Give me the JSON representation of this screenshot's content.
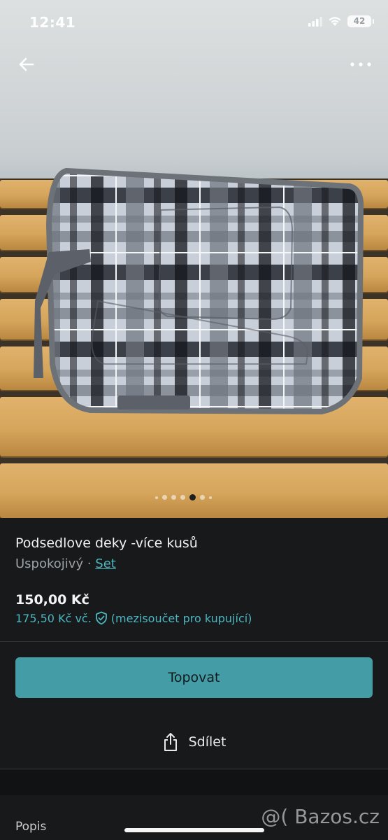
{
  "status_bar": {
    "time": "12:41",
    "battery": "42"
  },
  "gallery": {
    "pages": 7,
    "active_index": 4
  },
  "listing": {
    "title": "Podsedlove deky -více kusů",
    "condition": "Uspokojivý",
    "separator": "·",
    "category": "Set",
    "price": "150,00 Kč",
    "price_incl": "175,50 Kč vč.",
    "price_incl_note": "(mezisoučet pro kupující)"
  },
  "actions": {
    "bump_label": "Topovat",
    "share_label": "Sdílet"
  },
  "description": {
    "label": "Popis"
  },
  "watermark": "@( Bazos.cz",
  "icons": [
    "back-arrow-icon",
    "more-icon",
    "shield-check-icon",
    "share-icon",
    "signal-icon",
    "wifi-icon"
  ],
  "colors": {
    "accent": "#449da6",
    "link": "#4db6c0",
    "background": "#17191b"
  }
}
